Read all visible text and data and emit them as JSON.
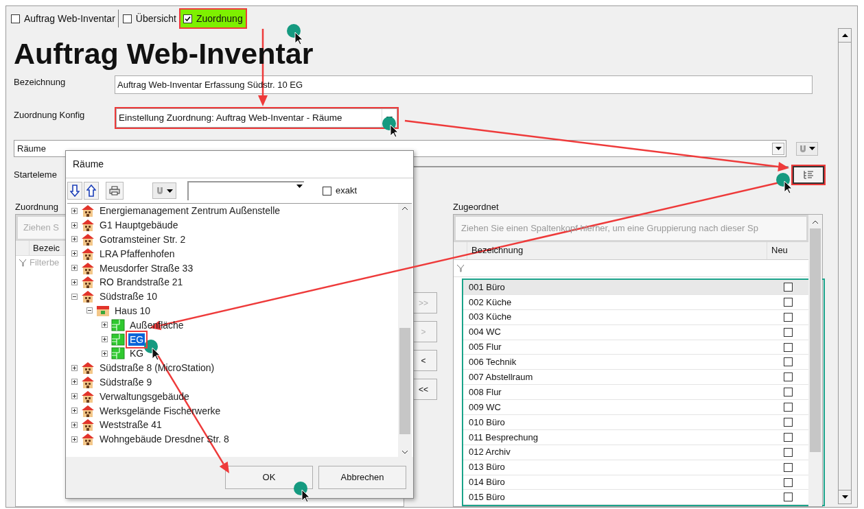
{
  "tabs": [
    {
      "label": "Auftrag Web-Inventar",
      "checked": false,
      "selected": false,
      "highlighted": false
    },
    {
      "label": "Übersicht",
      "checked": false,
      "selected": false,
      "highlighted": false
    },
    {
      "label": "Zuordnung",
      "checked": true,
      "selected": true,
      "highlighted": true
    }
  ],
  "title": "Auftrag Web-Inventar",
  "form": {
    "bezeichnung": {
      "label": "Bezeichnung",
      "value": "Auftrag Web-Inventar Erfassung Südstr. 10 EG"
    },
    "konfig": {
      "label": "Zuordnung Konfig",
      "value": "Einstellung Zuordnung: Auftrag Web-Inventar - Räume",
      "highlighted": true
    },
    "type_select": {
      "value": "Räume"
    },
    "start": {
      "label": "Starteleme",
      "button_highlighted": true
    }
  },
  "left_panel": {
    "label": "Zuordnung",
    "group_hint": "Ziehen S",
    "column": "Bezeic",
    "filter_placeholder": "Filterbe"
  },
  "move_buttons": [
    {
      "label": ">>",
      "disabled": true
    },
    {
      "label": ">",
      "disabled": true
    },
    {
      "label": "<",
      "disabled": false
    },
    {
      "label": "<<",
      "disabled": false
    }
  ],
  "right_panel": {
    "label": "Zugeordnet",
    "group_hint": "Ziehen Sie einen Spaltenkopf hierher, um eine Gruppierung nach dieser Sp",
    "columns": [
      "Bezeichnung",
      "Neu"
    ],
    "rows_highlighted": true,
    "rows": [
      {
        "name": "001 Büro",
        "neu": false,
        "selected": true
      },
      {
        "name": "002 Küche",
        "neu": false,
        "selected": false
      },
      {
        "name": "003 Küche",
        "neu": false,
        "selected": false
      },
      {
        "name": "004 WC",
        "neu": false,
        "selected": false
      },
      {
        "name": "005 Flur",
        "neu": false,
        "selected": false
      },
      {
        "name": "006 Technik",
        "neu": false,
        "selected": false
      },
      {
        "name": "007 Abstellraum",
        "neu": false,
        "selected": false
      },
      {
        "name": "008 Flur",
        "neu": false,
        "selected": false
      },
      {
        "name": "009 WC",
        "neu": false,
        "selected": false
      },
      {
        "name": "010 Büro",
        "neu": false,
        "selected": false
      },
      {
        "name": "011 Besprechung",
        "neu": false,
        "selected": false
      },
      {
        "name": "012 Archiv",
        "neu": false,
        "selected": false
      },
      {
        "name": "013 Büro",
        "neu": false,
        "selected": false
      },
      {
        "name": "014 Büro",
        "neu": false,
        "selected": false
      },
      {
        "name": "015 Büro",
        "neu": false,
        "selected": false
      }
    ]
  },
  "dialog": {
    "title": "Räume",
    "exakt": {
      "label": "exakt",
      "checked": false
    },
    "tree": [
      {
        "label": "Energiemanagement Zentrum Außenstelle",
        "kind": "building",
        "expanded": false,
        "selected": false,
        "highlighted": false
      },
      {
        "label": "G1 Hauptgebäude",
        "kind": "building",
        "expanded": false,
        "selected": false,
        "highlighted": false
      },
      {
        "label": "Gotramsteiner Str. 2",
        "kind": "building",
        "expanded": false,
        "selected": false,
        "highlighted": false
      },
      {
        "label": "LRA Pfaffenhofen",
        "kind": "building",
        "expanded": false,
        "selected": false,
        "highlighted": false
      },
      {
        "label": "Meusdorfer Straße 33",
        "kind": "building",
        "expanded": false,
        "selected": false,
        "highlighted": false
      },
      {
        "label": "RO Brandstraße 21",
        "kind": "building",
        "expanded": false,
        "selected": false,
        "highlighted": false
      },
      {
        "label": "Südstraße 10",
        "kind": "building",
        "expanded": true,
        "selected": false,
        "highlighted": false,
        "children": [
          {
            "label": "Haus 10",
            "kind": "house",
            "expanded": true,
            "selected": false,
            "highlighted": false,
            "children": [
              {
                "label": "Außenfläche",
                "kind": "floor",
                "expanded": false,
                "selected": false,
                "highlighted": false
              },
              {
                "label": "EG",
                "kind": "floor",
                "expanded": false,
                "selected": true,
                "highlighted": true
              },
              {
                "label": "KG",
                "kind": "floor",
                "expanded": false,
                "selected": false,
                "highlighted": false
              }
            ]
          }
        ]
      },
      {
        "label": "Südstraße 8 (MicroStation)",
        "kind": "building",
        "expanded": false,
        "selected": false,
        "highlighted": false
      },
      {
        "label": "Südstraße 9",
        "kind": "building",
        "expanded": false,
        "selected": false,
        "highlighted": false
      },
      {
        "label": "Verwaltungsgebäude",
        "kind": "building",
        "expanded": false,
        "selected": false,
        "highlighted": false
      },
      {
        "label": "Werksgelände Fischerwerke",
        "kind": "building",
        "expanded": false,
        "selected": false,
        "highlighted": false
      },
      {
        "label": "Weststraße 41",
        "kind": "building",
        "expanded": false,
        "selected": false,
        "highlighted": false
      },
      {
        "label": "Wohngebäude Dresdner Str. 8",
        "kind": "building",
        "expanded": false,
        "selected": false,
        "highlighted": false
      }
    ],
    "buttons": [
      "OK",
      "Abbrechen"
    ]
  }
}
